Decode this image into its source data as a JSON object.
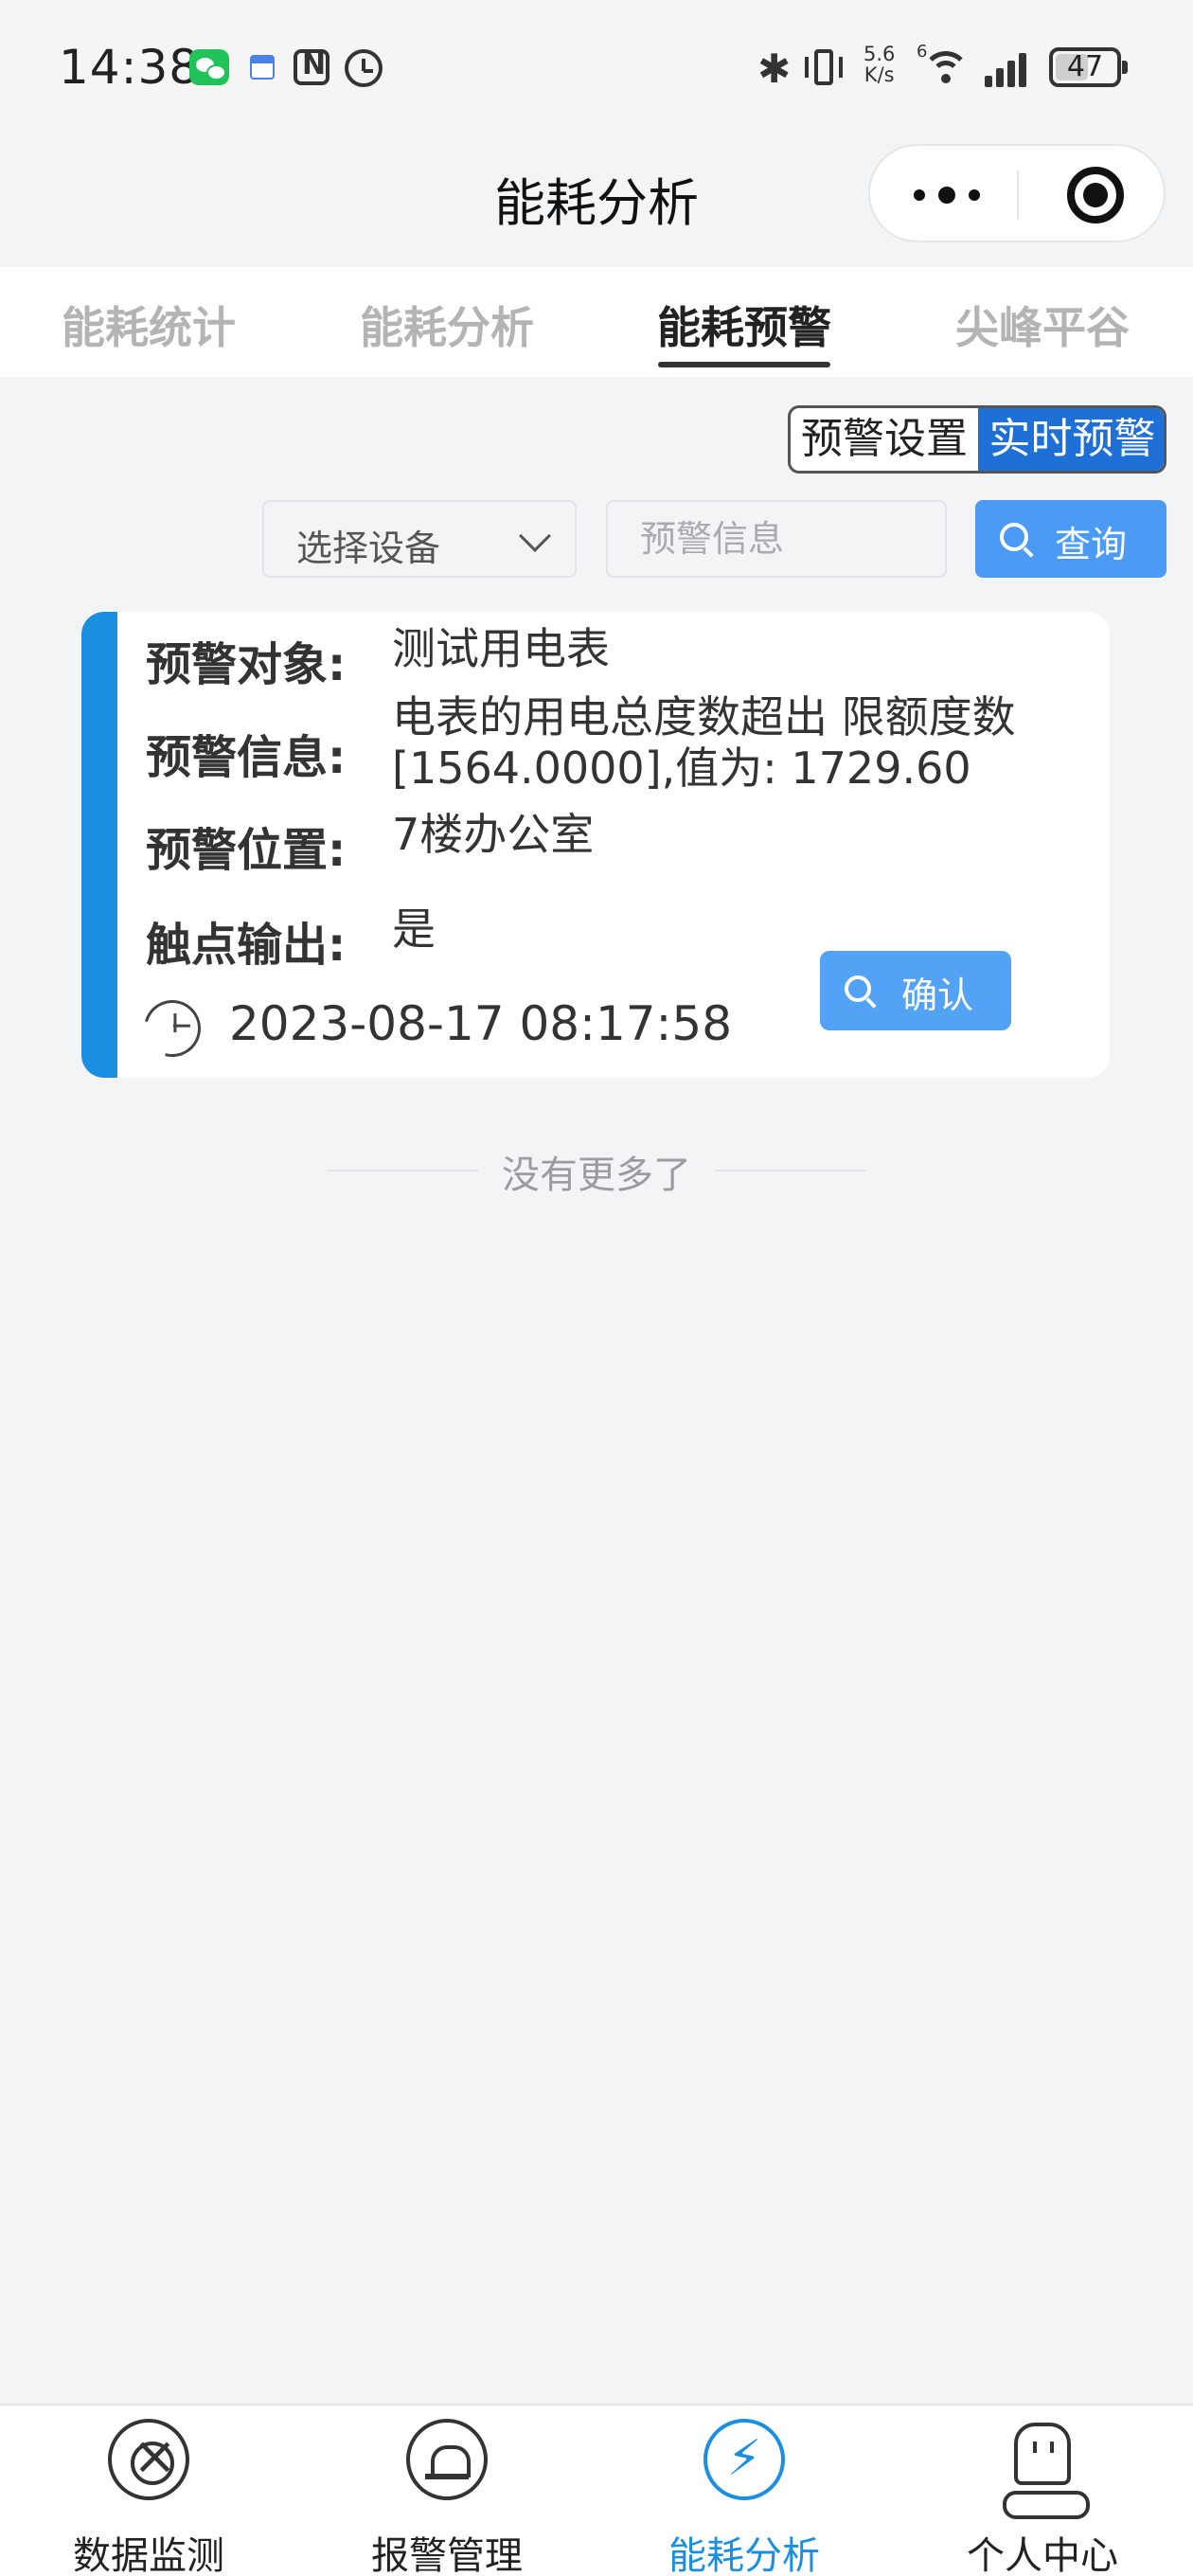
{
  "status_bar": {
    "time": "14:38",
    "net_speed_value": "5.6",
    "net_speed_unit": "K/s",
    "wifi_label": "6",
    "battery": "47"
  },
  "nav": {
    "title": "能耗分析"
  },
  "tabs": [
    {
      "label": "能耗统计"
    },
    {
      "label": "能耗分析"
    },
    {
      "label": "能耗预警"
    },
    {
      "label": "尖峰平谷"
    }
  ],
  "active_tab": "能耗预警",
  "mode_toggle": {
    "settings": "预警设置",
    "realtime": "实时预警"
  },
  "filter": {
    "device_select": "选择设备",
    "info_placeholder": "预警信息",
    "query_label": "查询"
  },
  "alerts": [
    {
      "object_label": "预警对象:",
      "object_value": "测试用电表",
      "info_label": "预警信息:",
      "info_value": "电表的用电总度数超出 限额度数[1564.0000],值为: 1729.60",
      "location_label": "预警位置:",
      "location_value": "7楼办公室",
      "contact_label": "触点输出:",
      "contact_value": "是",
      "time": "2023-08-17 08:17:58",
      "confirm_label": "确认"
    }
  ],
  "list_end_text": "没有更多了",
  "bottom_tabs": [
    {
      "label": "数据监测",
      "icon": "radar-icon"
    },
    {
      "label": "报警管理",
      "icon": "siren-icon"
    },
    {
      "label": "能耗分析",
      "icon": "bolt-icon"
    },
    {
      "label": "个人中心",
      "icon": "user-icon"
    }
  ],
  "colors": {
    "accent": "#1a8fe0",
    "primary_button": "#4b9af5",
    "toggle_active": "#1e6fd6",
    "background": "#f3f4f6"
  }
}
